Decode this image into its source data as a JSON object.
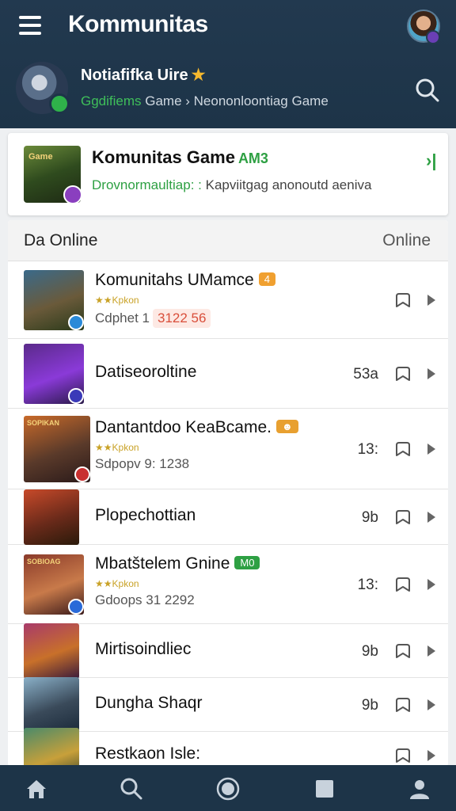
{
  "app": {
    "title": "Kommunitas"
  },
  "notification": {
    "title": "Notiafifka Uire",
    "star": "★",
    "sub_green": "Ggdifiems",
    "sub_rest": " Game › Neononloontiag Game"
  },
  "featured": {
    "title": "Komunitas Game",
    "tag": "AM3",
    "sub_green": "Drovnormaultiap: :",
    "sub_rest": " Kapviitgag anonoutd aeniva",
    "arrow": "›|"
  },
  "list": {
    "header_left": "Da Online",
    "header_right": "Online",
    "items": [
      {
        "title": "Komunitahs UMamce",
        "tag": "4",
        "tag_color": "#f0a030",
        "stars": "★★Kpkon",
        "meta": "Cdphet 1",
        "price": "3122 56",
        "count": "",
        "thumb_label": "",
        "thumb_colors": [
          "#3a6a8a",
          "#6a5a3a",
          "#2a3a1a"
        ],
        "badge_color": "#2a8ad8"
      },
      {
        "title": "Datiseoroltine",
        "tag": "",
        "tag_color": "",
        "stars": "",
        "meta": "",
        "price": "",
        "count": "53a",
        "thumb_label": "",
        "thumb_colors": [
          "#5a2a8a",
          "#8a3ad8",
          "#2a1a4a"
        ],
        "badge_color": "#3a3ab8"
      },
      {
        "title": "Dantantdoo KeaBcame.",
        "tag": "☻",
        "tag_color": "#e8a030",
        "stars": "★★Kpkon",
        "meta": "Sdpopv 9: 1238",
        "price": "",
        "count": "13:",
        "thumb_label": "SOPIKAN",
        "thumb_colors": [
          "#c86a2a",
          "#5a3a2a",
          "#2a1a1a"
        ],
        "badge_color": "#c83030"
      },
      {
        "title": "Plopechottian",
        "tag": "",
        "tag_color": "",
        "stars": "",
        "meta": "",
        "price": "",
        "count": "9b",
        "thumb_label": "",
        "thumb_colors": [
          "#c84a2a",
          "#6a2a1a",
          "#2a1a0a"
        ],
        "badge_color": ""
      },
      {
        "title": "Mbatštelem Gnine",
        "tag": "M0",
        "tag_color": "#2ea043",
        "stars": "★★Kpkon",
        "meta": "Gdoops 31 2292",
        "price": "",
        "count": "13:",
        "thumb_label": "SOBIOAG",
        "thumb_colors": [
          "#8a3a2a",
          "#c87a4a",
          "#3a1a1a"
        ],
        "badge_color": "#2a6ad8"
      },
      {
        "title": "Mirtisoindliec",
        "tag": "",
        "tag_color": "",
        "stars": "",
        "meta": "",
        "price": "",
        "count": "9b",
        "thumb_label": "",
        "thumb_colors": [
          "#a83a6a",
          "#c8702a",
          "#3a1a3a"
        ],
        "badge_color": ""
      },
      {
        "title": "Dungha Shaqr",
        "tag": "",
        "tag_color": "",
        "stars": "",
        "meta": "",
        "price": "",
        "count": "9b",
        "thumb_label": "",
        "thumb_colors": [
          "#8ab0c8",
          "#3a4a5a",
          "#1a2a3a"
        ],
        "badge_color": ""
      },
      {
        "title": "Restkaon Isle:",
        "tag": "",
        "tag_color": "",
        "stars": "",
        "meta": "",
        "price": "",
        "count": "",
        "thumb_label": "",
        "thumb_colors": [
          "#4a8a6a",
          "#c8a03a",
          "#2a3a2a"
        ],
        "badge_color": ""
      }
    ]
  },
  "bottom_nav": [
    "home-icon",
    "search-icon",
    "record-icon",
    "square-icon",
    "profile-icon"
  ],
  "colors": {
    "topbar": "#1d3448",
    "accent_green": "#2ea043",
    "price_red": "#d94e3a"
  }
}
